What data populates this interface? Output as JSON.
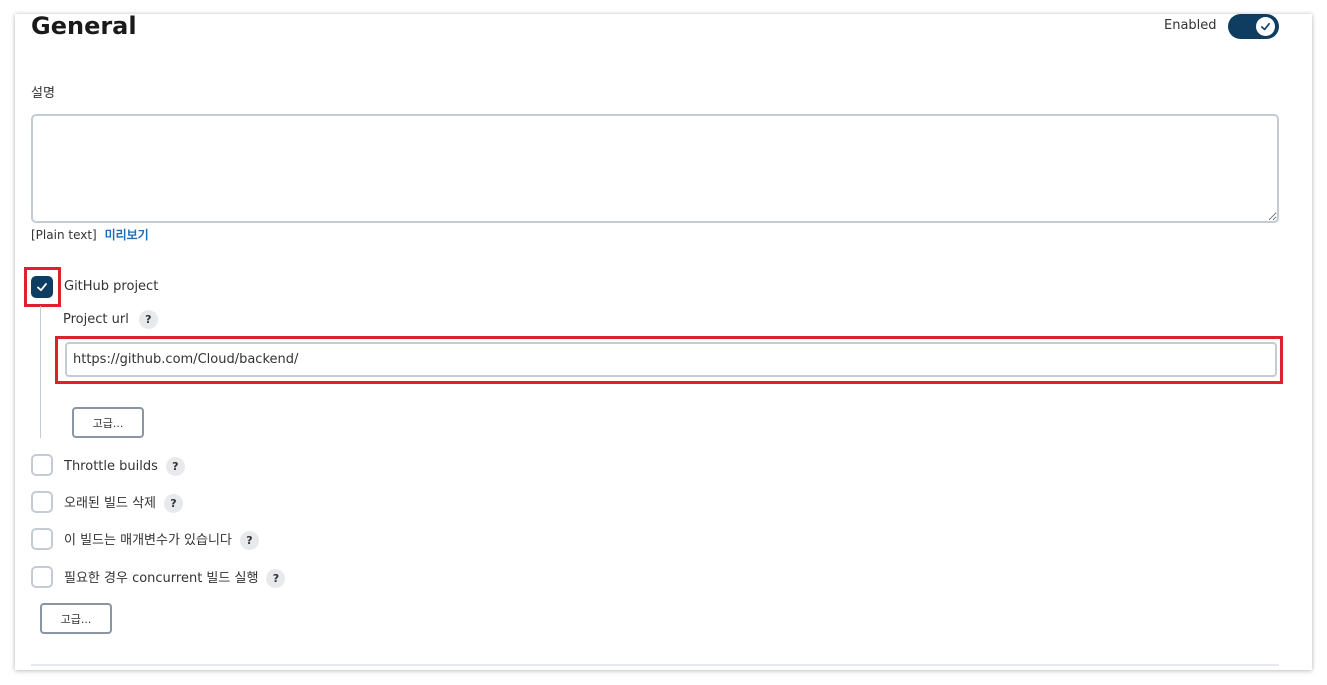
{
  "section": {
    "title": "General",
    "enabled_label": "Enabled",
    "enabled": true
  },
  "description": {
    "label": "설명",
    "value": "",
    "format_note": "[Plain text]",
    "preview_link": "미리보기"
  },
  "github_project": {
    "label": "GitHub project",
    "checked": true,
    "url_label": "Project url",
    "url_value": "https://github.com/Cloud/backend/",
    "advanced_button": "고급..."
  },
  "options": [
    {
      "label": "Throttle builds",
      "checked": false
    },
    {
      "label": "오래된 빌드 삭제",
      "checked": false
    },
    {
      "label": "이 빌드는 매개변수가 있습니다",
      "checked": false
    },
    {
      "label": "필요한 경우 concurrent 빌드 실행",
      "checked": false
    }
  ],
  "advanced_button": "고급...",
  "help_glyph": "?",
  "colors": {
    "accent": "#0f3d61",
    "highlight": "#e0202b",
    "link": "#1f6fb8"
  }
}
